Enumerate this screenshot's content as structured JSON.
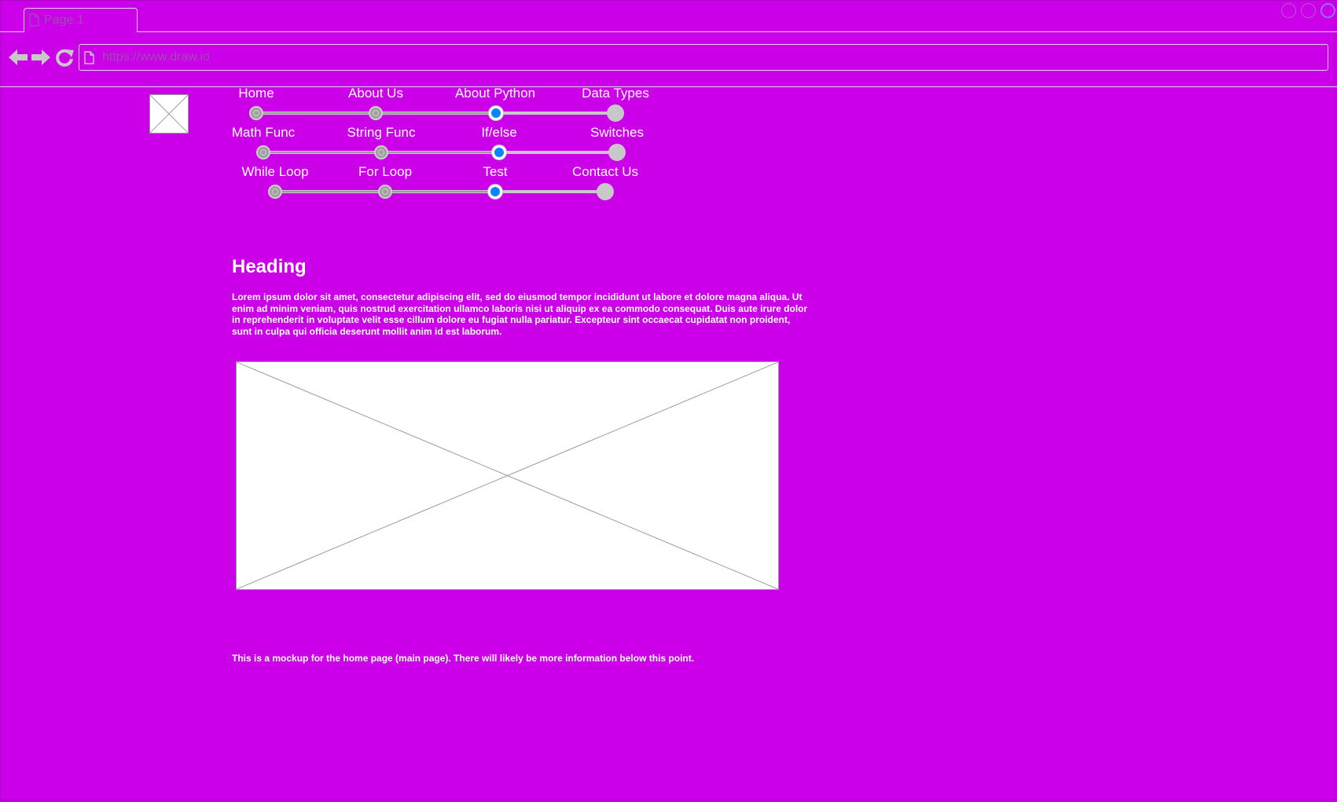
{
  "browser": {
    "tab_title": "Page 1",
    "url": "https://www.draw.io"
  },
  "nav": {
    "rows": [
      {
        "items": [
          "Home",
          "About Us",
          "About Python",
          "Data Types"
        ],
        "current": 2
      },
      {
        "items": [
          "Math Func",
          "String Func",
          "If/else",
          "Switches"
        ],
        "current": 2
      },
      {
        "items": [
          "While Loop",
          "For Loop",
          "Test",
          "Contact Us"
        ],
        "current": 2
      }
    ]
  },
  "content": {
    "heading": "Heading",
    "paragraph": "Lorem ipsum dolor sit amet, consectetur adipiscing elit, sed do eiusmod tempor incididunt ut labore et dolore magna aliqua. Ut enim ad minim veniam, quis nostrud exercitation ullamco laboris nisi ut aliquip ex ea commodo consequat. Duis aute irure dolor in reprehenderit in voluptate velit esse cillum dolore eu fugiat nulla pariatur. Excepteur sint occaecat cupidatat non proident, sunt in culpa qui officia deserunt mollit anim id est laborum.",
    "footnote": "This is a mockup for the home page (main page). There will likely be more information below this point."
  },
  "colors": {
    "background": "#cc00e8",
    "current_step": "#0a84ff",
    "step_gray": "#c8c8c8"
  },
  "icons": [
    "page-icon",
    "back-arrow-icon",
    "forward-arrow-icon",
    "reload-icon",
    "image-placeholder-icon"
  ]
}
